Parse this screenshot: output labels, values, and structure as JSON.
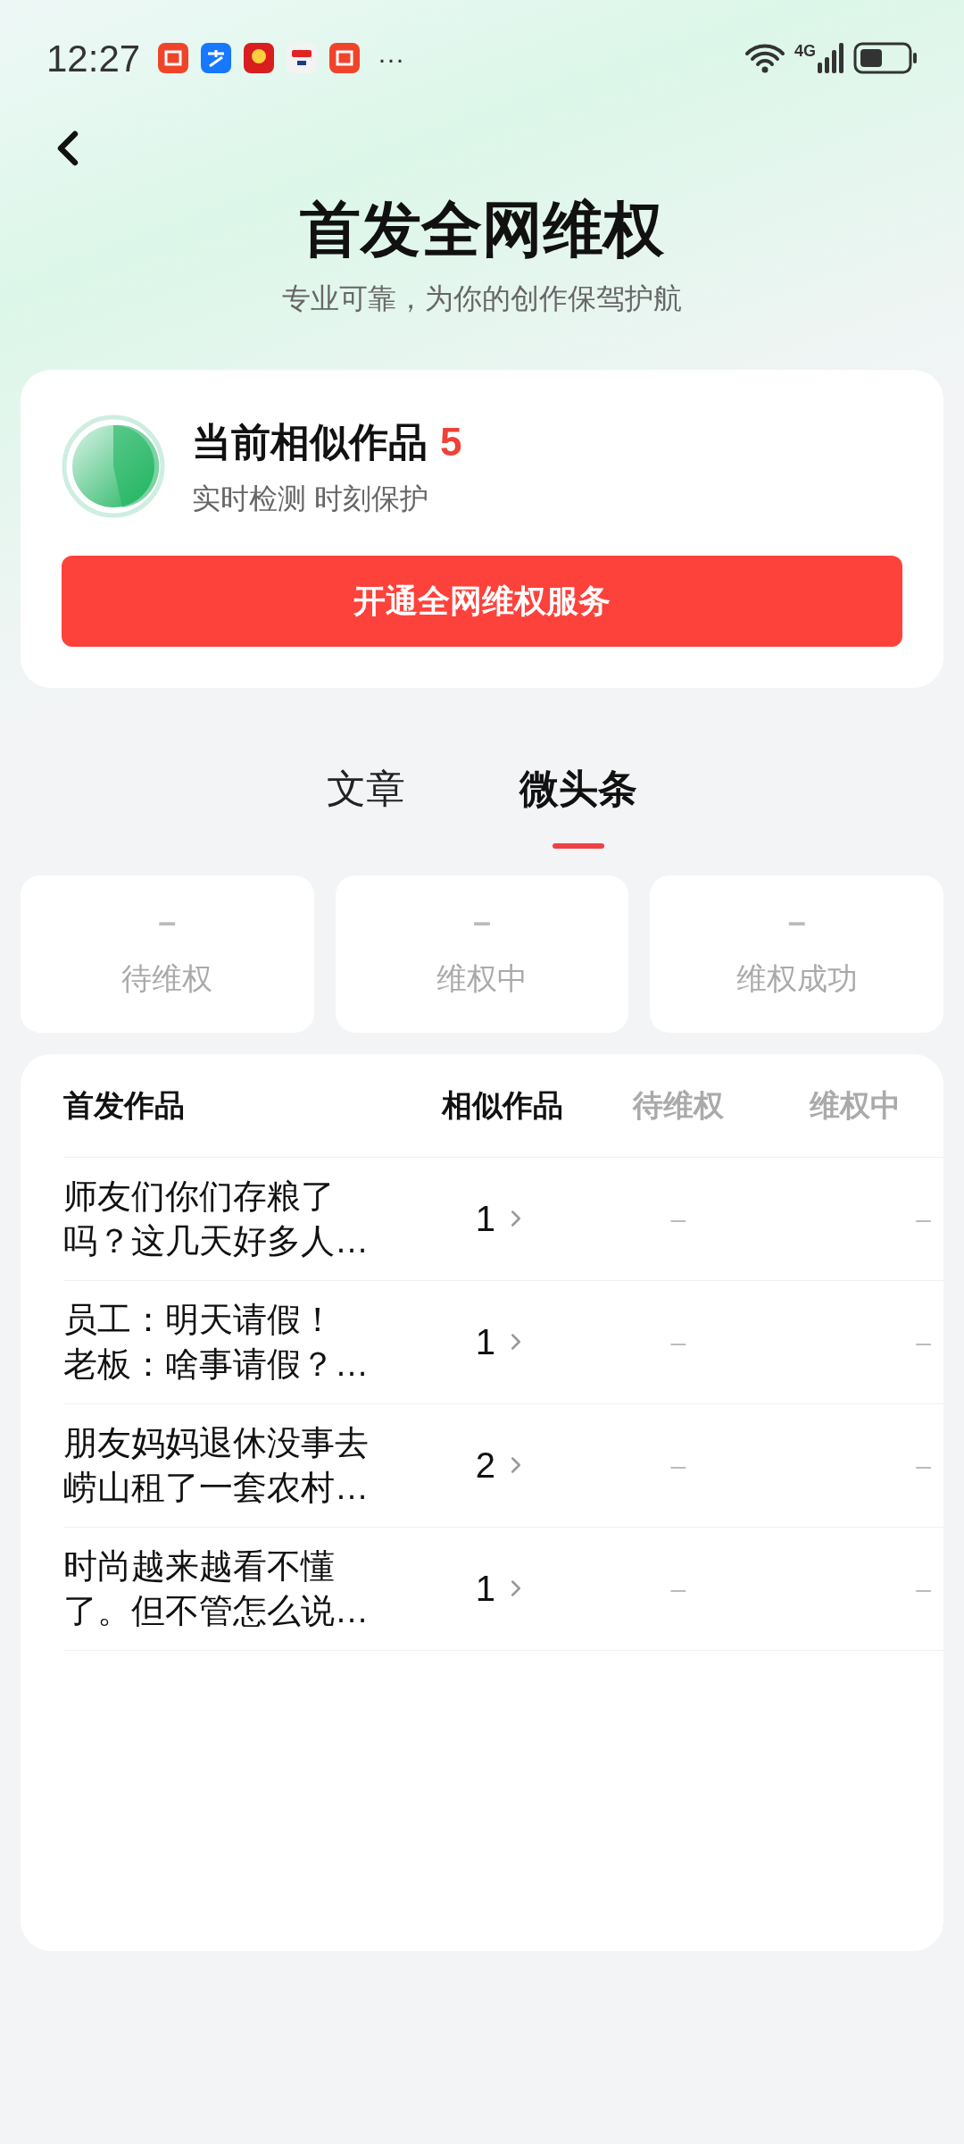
{
  "status_bar": {
    "time": "12:27",
    "more": "···",
    "network": "4G"
  },
  "header": {
    "title": "首发全网维权",
    "subtitle": "专业可靠，为你的创作保驾护航"
  },
  "summary": {
    "label": "当前相似作品",
    "count": "5",
    "caption": "实时检测 时刻保护",
    "button": "开通全网维权服务"
  },
  "tabs": [
    {
      "label": "文章",
      "selected": false
    },
    {
      "label": "微头条",
      "selected": true
    }
  ],
  "stats": [
    {
      "value": "–",
      "label": "待维权"
    },
    {
      "value": "–",
      "label": "维权中"
    },
    {
      "value": "–",
      "label": "维权成功"
    }
  ],
  "table": {
    "columns": [
      {
        "label": "首发作品",
        "disabled": false
      },
      {
        "label": "相似作品",
        "disabled": false
      },
      {
        "label": "待维权",
        "disabled": true
      },
      {
        "label": "维权中",
        "disabled": true
      }
    ],
    "rows": [
      {
        "lines": [
          "师友们你们存粮了",
          "吗？这几天好多人…"
        ],
        "similar": "1",
        "pending": "–",
        "in_progress": "–"
      },
      {
        "lines": [
          "员工：明天请假！",
          "老板：啥事请假？…"
        ],
        "similar": "1",
        "pending": "–",
        "in_progress": "–"
      },
      {
        "lines": [
          "朋友妈妈退休没事去",
          "崂山租了一套农村…"
        ],
        "similar": "2",
        "pending": "–",
        "in_progress": "–"
      },
      {
        "lines": [
          "时尚越来越看不懂",
          "了。但不管怎么说…"
        ],
        "similar": "1",
        "pending": "–",
        "in_progress": "–"
      }
    ]
  }
}
